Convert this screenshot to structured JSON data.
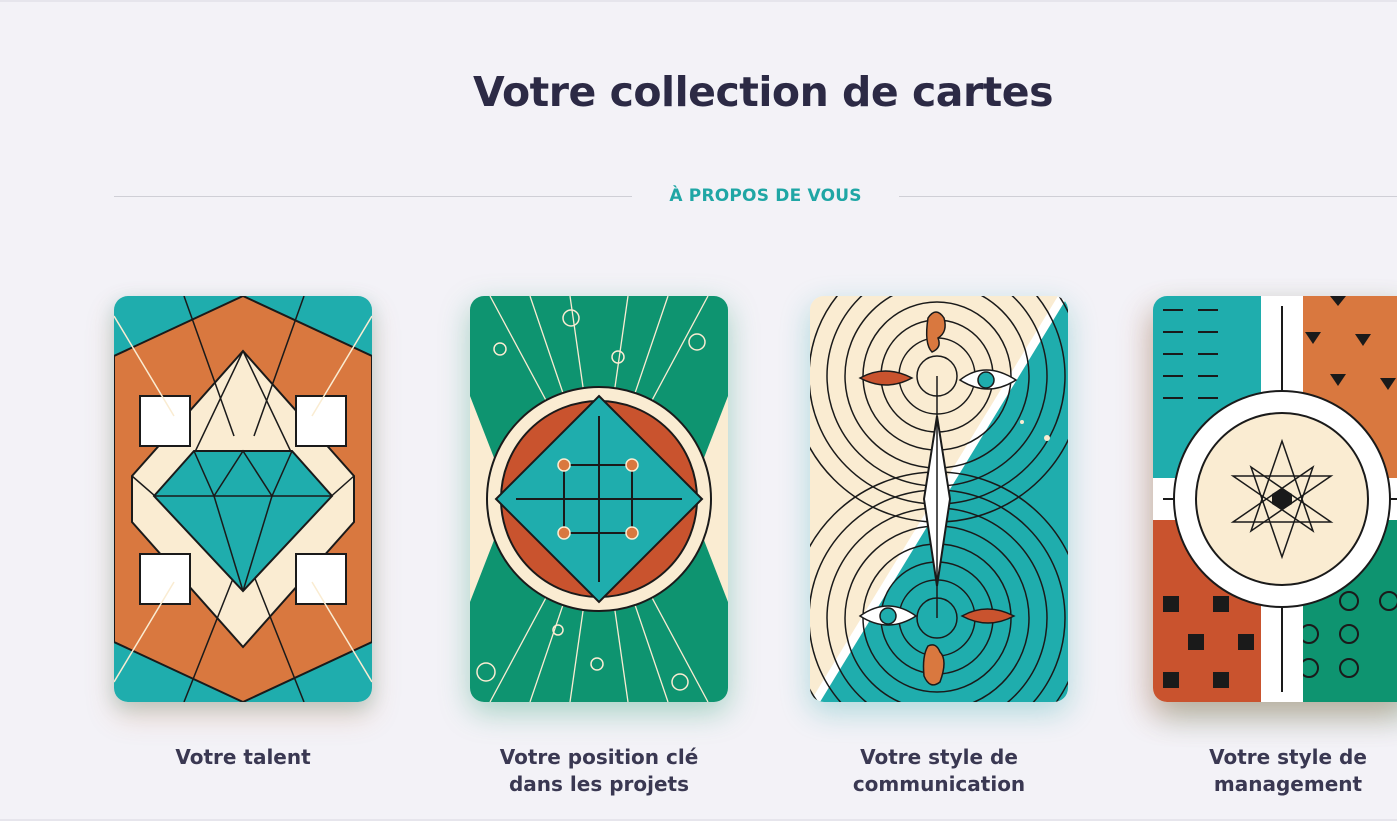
{
  "page": {
    "title": "Votre collection de cartes",
    "section_label": "À PROPOS DE VOUS"
  },
  "colors": {
    "background": "#f3f2f7",
    "title": "#2c2a45",
    "section_label": "#1fa6a5",
    "teal": "#1fadad",
    "orange": "#d9783f",
    "cream": "#faecd2",
    "green": "#0e9470",
    "rust": "#c9532e"
  },
  "cards": [
    {
      "caption_line1": "Votre talent",
      "caption_line2": "",
      "icon": "diamond-icon"
    },
    {
      "caption_line1": "Votre position clé",
      "caption_line2": "dans les projets",
      "icon": "grid-circle-icon"
    },
    {
      "caption_line1": "Votre style de",
      "caption_line2": "communication",
      "icon": "eye-ear-mouth-icon"
    },
    {
      "caption_line1": "Votre style de",
      "caption_line2": "management",
      "icon": "star-compass-icon"
    }
  ]
}
